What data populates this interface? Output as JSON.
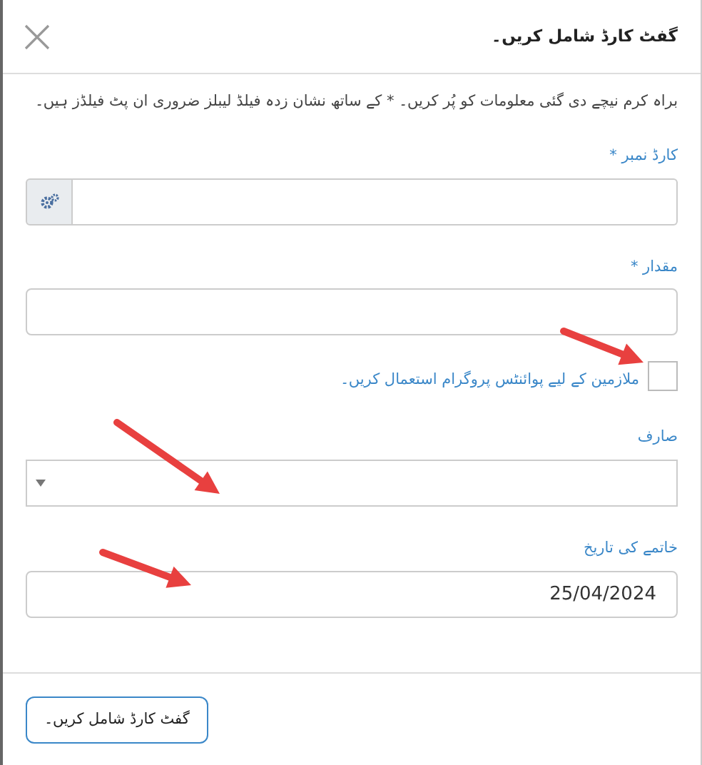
{
  "dialog": {
    "title": "گفٹ کارڈ شامل کریں۔"
  },
  "intro": "براہ کرم نیچے دی گئی معلومات کو پُر کریں۔ * کے ساتھ نشان زدہ فیلڈ لیبلز ضروری ان پٹ فیلڈز ہیں۔",
  "fields": [
    {
      "kind": "addon",
      "label": "کارڈ نمبر *"
    },
    {
      "kind": "text",
      "label": "مقدار *"
    },
    {
      "kind": "checkbox",
      "label": "ملازمین کے لیے پوائنٹس پروگرام استعمال کریں۔",
      "checked": false
    },
    {
      "kind": "select",
      "label": "صارف"
    },
    {
      "kind": "text",
      "label": "خاتمے کی تاریخ",
      "value": "25/04/2024"
    }
  ],
  "buttons": [
    "گفٹ کارڈ شامل کریں۔"
  ]
}
